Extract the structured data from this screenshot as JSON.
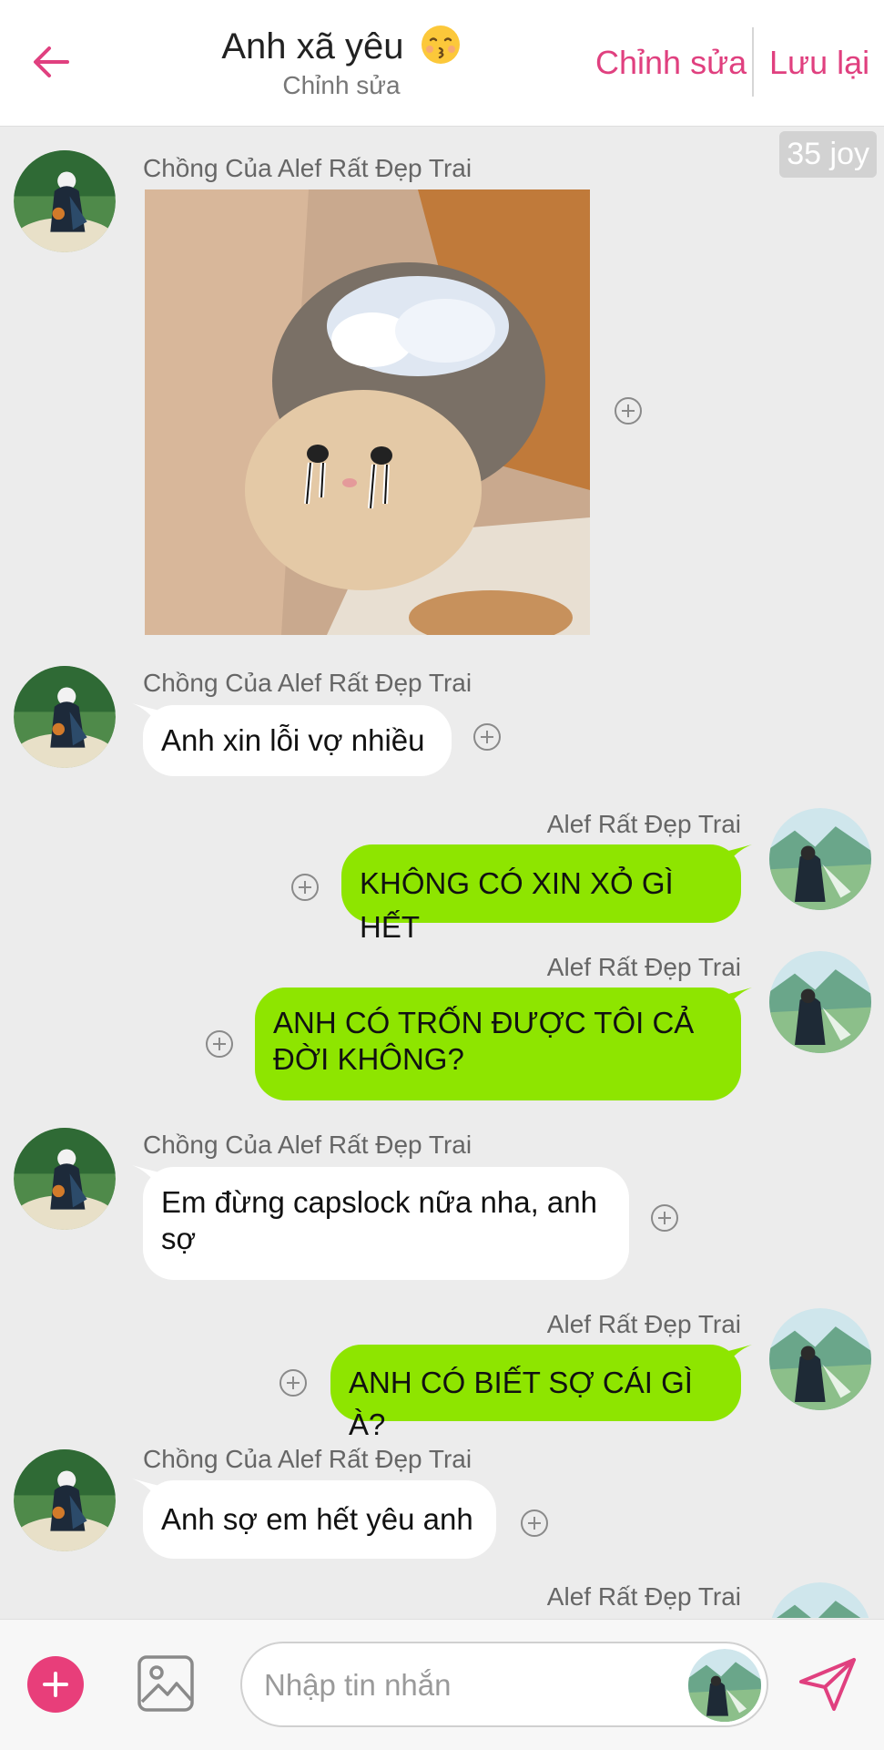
{
  "header": {
    "title": "Anh xã yêu",
    "title_emoji": "kissing-face-emoji",
    "subtitle": "Chỉnh sửa",
    "edit_label": "Chỉnh sửa",
    "save_label": "Lưu lại",
    "accent_color": "#e0407f"
  },
  "badge": {
    "text": "35 joy"
  },
  "messages": [
    {
      "side": "left",
      "sender": "Chồng Của Alef Rất Đẹp Trai",
      "type": "image",
      "image": "crying-cat-sticker"
    },
    {
      "side": "left",
      "sender": "Chồng Của Alef Rất Đẹp Trai",
      "type": "text",
      "text": "Anh xin lỗi vợ nhiều"
    },
    {
      "side": "right",
      "sender": "Alef Rất Đẹp Trai",
      "type": "text",
      "text": "KHÔNG CÓ XIN XỎ GÌ HẾT"
    },
    {
      "side": "right",
      "sender": "Alef Rất Đẹp Trai",
      "type": "text",
      "text": "ANH CÓ TRỐN ĐƯỢC TÔI CẢ ĐỜI KHÔNG?"
    },
    {
      "side": "left",
      "sender": "Chồng Của Alef Rất Đẹp Trai",
      "type": "text",
      "text": "Em đừng capslock nữa nha, anh sợ"
    },
    {
      "side": "right",
      "sender": "Alef Rất Đẹp Trai",
      "type": "text",
      "text": "ANH CÓ BIẾT SỢ CÁI GÌ À?"
    },
    {
      "side": "left",
      "sender": "Chồng Của Alef Rất Đẹp Trai",
      "type": "text",
      "text": "Anh sợ em hết yêu anh"
    },
    {
      "side": "right",
      "sender": "Alef Rất Đẹp Trai",
      "type": "partial"
    }
  ],
  "composer": {
    "placeholder": "Nhập tin nhắn",
    "add_icon": "plus-circle-icon",
    "image_icon": "image-icon",
    "send_icon": "send-icon"
  },
  "colors": {
    "my_bubble": "#8ee500",
    "their_bubble": "#ffffff",
    "background": "#ececec"
  }
}
